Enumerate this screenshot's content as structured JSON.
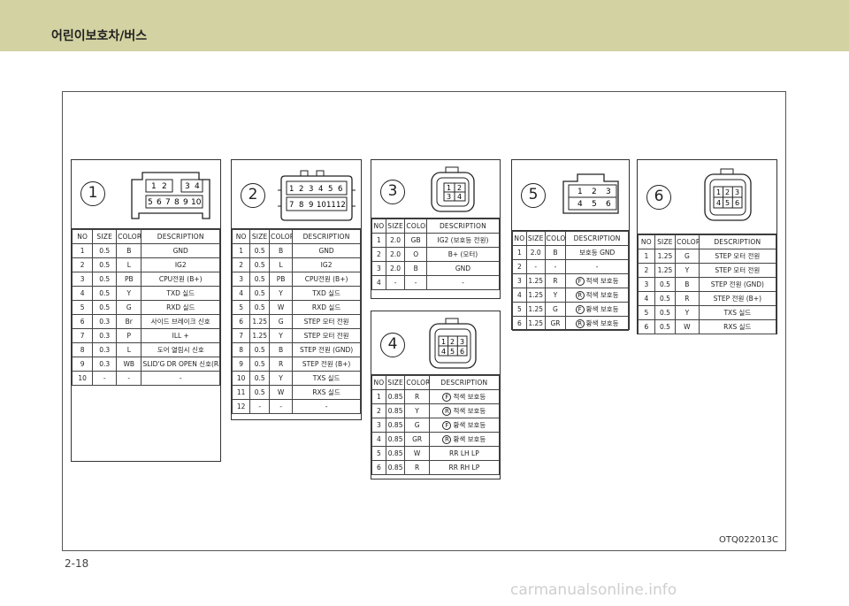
{
  "header": {
    "title": "어린이보호차/버스"
  },
  "figure_code": "OTQ022013C",
  "page_number": "2-18",
  "watermark": "carmanualsonline.info",
  "connectors": [
    {
      "number": "1",
      "pins": [
        "1",
        "2",
        "3",
        "4",
        "5",
        "6",
        "7",
        "8",
        "9",
        "10"
      ],
      "table": {
        "headers": [
          "NO",
          "SIZE",
          "COLOR",
          "DESCRIPTION"
        ],
        "rows": [
          [
            "1",
            "0.5",
            "B",
            "GND"
          ],
          [
            "2",
            "0.5",
            "L",
            "IG2"
          ],
          [
            "3",
            "0.5",
            "PB",
            "CPU전원 (B+)"
          ],
          [
            "4",
            "0.5",
            "Y",
            "TXD 실드"
          ],
          [
            "5",
            "0.5",
            "G",
            "RXD 실드"
          ],
          [
            "6",
            "0.3",
            "Br",
            "사이드 브레이크 신호"
          ],
          [
            "7",
            "0.3",
            "P",
            "ILL +"
          ],
          [
            "8",
            "0.3",
            "L",
            "도어 열림시 신호"
          ],
          [
            "9",
            "0.3",
            "WB",
            "SLID'G DR OPEN 신호(RH)"
          ],
          [
            "10",
            "-",
            "-",
            "-"
          ]
        ]
      }
    },
    {
      "number": "2",
      "pins": [
        "1",
        "2",
        "3",
        "4",
        "5",
        "6",
        "7",
        "8",
        "9",
        "10",
        "11",
        "12"
      ],
      "table": {
        "headers": [
          "NO",
          "SIZE",
          "COLOR",
          "DESCRIPTION"
        ],
        "rows": [
          [
            "1",
            "0.5",
            "B",
            "GND"
          ],
          [
            "2",
            "0.5",
            "L",
            "IG2"
          ],
          [
            "3",
            "0.5",
            "PB",
            "CPU전원 (B+)"
          ],
          [
            "4",
            "0.5",
            "Y",
            "TXD 실드"
          ],
          [
            "5",
            "0.5",
            "W",
            "RXD 실드"
          ],
          [
            "6",
            "1.25",
            "G",
            "STEP 모터 전원"
          ],
          [
            "7",
            "1.25",
            "Y",
            "STEP 모터 전원"
          ],
          [
            "8",
            "0.5",
            "B",
            "STEP 전원 (GND)"
          ],
          [
            "9",
            "0.5",
            "R",
            "STEP 전원 (B+)"
          ],
          [
            "10",
            "0.5",
            "Y",
            "TXS 실드"
          ],
          [
            "11",
            "0.5",
            "W",
            "RXS 실드"
          ],
          [
            "12",
            "-",
            "-",
            "-"
          ]
        ]
      }
    },
    {
      "number": "3",
      "pins": [
        "1",
        "2",
        "3",
        "4"
      ],
      "table": {
        "headers": [
          "NO",
          "SIZE",
          "COLOR",
          "DESCRIPTION"
        ],
        "rows": [
          [
            "1",
            "2.0",
            "GB",
            "IG2 (보호등 전원)"
          ],
          [
            "2",
            "2.0",
            "O",
            "B+ (모터)"
          ],
          [
            "3",
            "2.0",
            "B",
            "GND"
          ],
          [
            "4",
            "-",
            "-",
            "-"
          ]
        ]
      }
    },
    {
      "number": "4",
      "pins": [
        "1",
        "2",
        "3",
        "4",
        "5",
        "6"
      ],
      "table": {
        "headers": [
          "NO",
          "SIZE",
          "COLOR",
          "DESCRIPTION"
        ],
        "rows": [
          [
            "1",
            "0.85",
            "R",
            "F",
            "적색 보호등"
          ],
          [
            "2",
            "0.85",
            "Y",
            "R",
            "적색 보호등"
          ],
          [
            "3",
            "0.85",
            "G",
            "F",
            "황색 보호등"
          ],
          [
            "4",
            "0.85",
            "GR",
            "R",
            "황색 보호등"
          ],
          [
            "5",
            "0.85",
            "W",
            "",
            "RR LH LP"
          ],
          [
            "6",
            "0.85",
            "R",
            "",
            "RR RH LP"
          ]
        ]
      }
    },
    {
      "number": "5",
      "pins": [
        "1",
        "2",
        "3",
        "4",
        "5",
        "6"
      ],
      "table": {
        "headers": [
          "NO",
          "SIZE",
          "COLOR",
          "DESCRIPTION"
        ],
        "rows": [
          [
            "1",
            "2.0",
            "B",
            "",
            "보호등 GND"
          ],
          [
            "2",
            "-",
            "-",
            "",
            "-"
          ],
          [
            "3",
            "1.25",
            "R",
            "F",
            "적색 보호등"
          ],
          [
            "4",
            "1.25",
            "Y",
            "R",
            "적색 보호등"
          ],
          [
            "5",
            "1.25",
            "G",
            "F",
            "황색 보호등"
          ],
          [
            "6",
            "1.25",
            "GR",
            "R",
            "황색 보호등"
          ]
        ]
      }
    },
    {
      "number": "6",
      "pins": [
        "1",
        "2",
        "3",
        "4",
        "5",
        "6"
      ],
      "table": {
        "headers": [
          "NO",
          "SIZE",
          "COLOR",
          "DESCRIPTION"
        ],
        "rows": [
          [
            "1",
            "1.25",
            "G",
            "STEP 모터 전원"
          ],
          [
            "2",
            "1.25",
            "Y",
            "STEP 모터 전원"
          ],
          [
            "3",
            "0.5",
            "B",
            "STEP 전원 (GND)"
          ],
          [
            "4",
            "0.5",
            "R",
            "STEP 전원 (B+)"
          ],
          [
            "5",
            "0.5",
            "Y",
            "TXS 실드"
          ],
          [
            "6",
            "0.5",
            "W",
            "RXS 실드"
          ]
        ]
      }
    }
  ]
}
